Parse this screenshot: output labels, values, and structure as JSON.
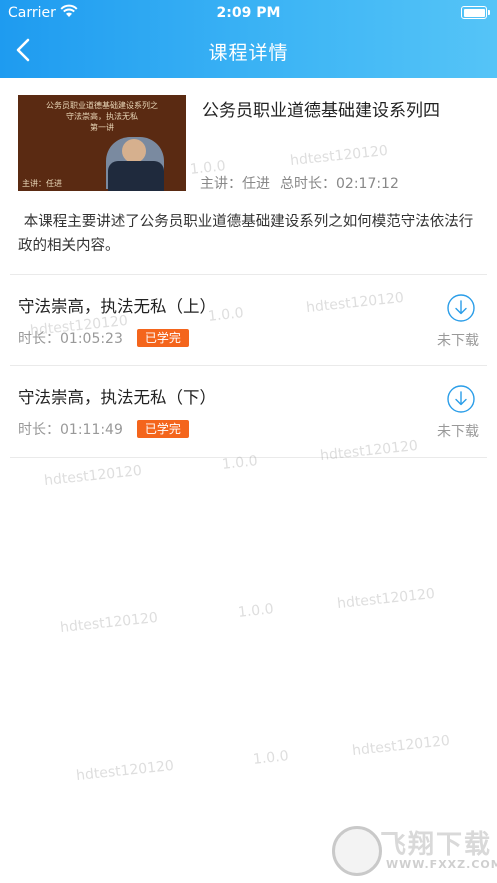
{
  "status_bar": {
    "carrier": "Carrier",
    "time": "2:09 PM"
  },
  "header": {
    "title": "课程详情"
  },
  "course": {
    "title": "公务员职业道德基础建设系列四",
    "lecturer": "主讲：任进",
    "duration": "总时长：02:17:12",
    "description": "本课程主要讲述了公务员职业道德基础建设系列之如何模范守法依法行政的相关内容。",
    "thumbnail_caption": {
      "line1": "公务员职业道德基础建设系列之",
      "line2": "守法崇高，执法无私",
      "line3": "第一讲",
      "line4": "主讲：任进"
    }
  },
  "lessons": [
    {
      "title": "守法崇高，执法无私（上）",
      "duration": "时长：01:05:23",
      "badge": "已学完",
      "download_label": "未下载"
    },
    {
      "title": "守法崇高，执法无私（下）",
      "duration": "时长：01:11:49",
      "badge": "已学完",
      "download_label": "未下载"
    }
  ],
  "watermark": {
    "user": "hdtest120120",
    "version": "1.0.0"
  },
  "brand": {
    "name": "飞翔下载",
    "url": "WWW.FXXZ.COM"
  },
  "colors": {
    "header_start": "#1e9bf0",
    "header_end": "#55c4f7",
    "badge": "#f4651c",
    "download_icon": "#2a9de8"
  }
}
